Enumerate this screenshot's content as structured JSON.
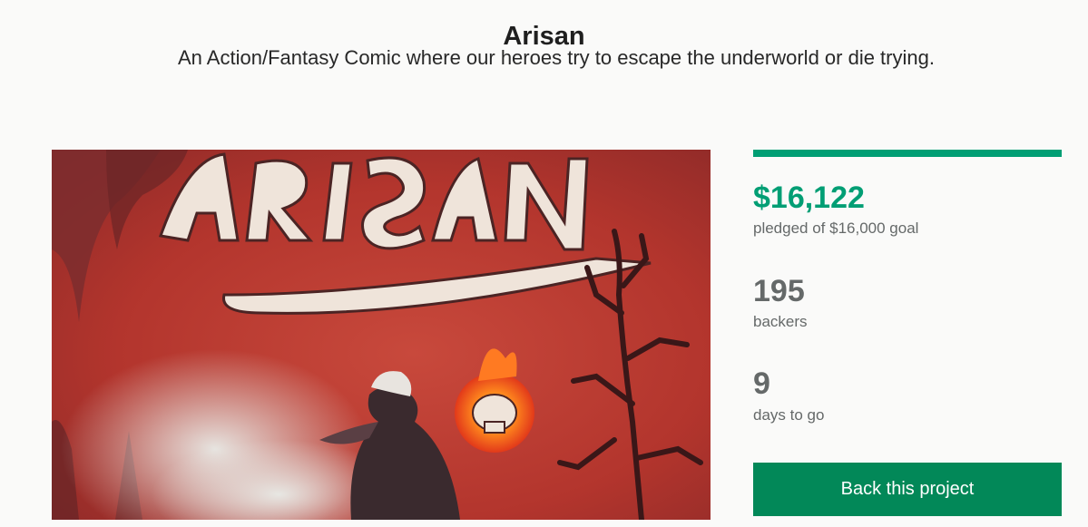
{
  "project": {
    "title": "Arisan",
    "subtitle": "An Action/Fantasy Comic where our heroes try to escape the underworld or die trying."
  },
  "hero": {
    "logo_text": "ARISAN",
    "image": "comic-cover-art"
  },
  "stats": {
    "progress_fraction": 1.0,
    "pledged": "$16,122",
    "pledged_label": "pledged of $16,000 goal",
    "backers": "195",
    "backers_label": "backers",
    "days": "9",
    "days_label": "days to go"
  },
  "cta": {
    "back_label": "Back this project"
  },
  "colors": {
    "accent": "#009e74",
    "button": "#028858",
    "muted_text": "#656969"
  }
}
